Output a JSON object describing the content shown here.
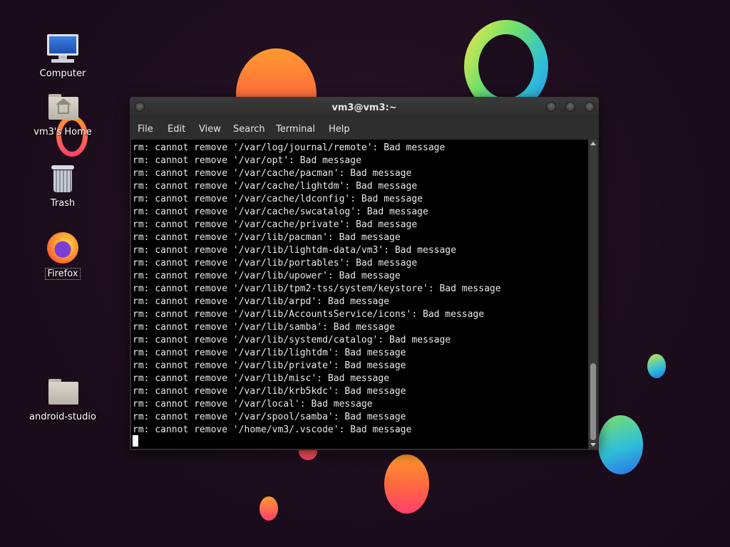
{
  "desktop": {
    "icons": [
      {
        "label": "Computer",
        "icon": "computer-icon"
      },
      {
        "label": "vm3's Home",
        "icon": "home-folder-icon"
      },
      {
        "label": "Trash",
        "icon": "trash-icon"
      },
      {
        "label": "Firefox",
        "icon": "firefox-icon"
      },
      {
        "label": "android-studio",
        "icon": "folder-icon"
      }
    ]
  },
  "terminal": {
    "title": "vm3@vm3:~",
    "menu": [
      "File",
      "Edit",
      "View",
      "Search",
      "Terminal",
      "Help"
    ],
    "lines": [
      "rm: cannot remove '/var/log/journal/remote': Bad message",
      "rm: cannot remove '/var/opt': Bad message",
      "rm: cannot remove '/var/cache/pacman': Bad message",
      "rm: cannot remove '/var/cache/lightdm': Bad message",
      "rm: cannot remove '/var/cache/ldconfig': Bad message",
      "rm: cannot remove '/var/cache/swcatalog': Bad message",
      "rm: cannot remove '/var/cache/private': Bad message",
      "rm: cannot remove '/var/lib/pacman': Bad message",
      "rm: cannot remove '/var/lib/lightdm-data/vm3': Bad message",
      "rm: cannot remove '/var/lib/portables': Bad message",
      "rm: cannot remove '/var/lib/upower': Bad message",
      "rm: cannot remove '/var/lib/tpm2-tss/system/keystore': Bad message",
      "rm: cannot remove '/var/lib/arpd': Bad message",
      "rm: cannot remove '/var/lib/AccountsService/icons': Bad message",
      "rm: cannot remove '/var/lib/samba': Bad message",
      "rm: cannot remove '/var/lib/systemd/catalog': Bad message",
      "rm: cannot remove '/var/lib/lightdm': Bad message",
      "rm: cannot remove '/var/lib/private': Bad message",
      "rm: cannot remove '/var/lib/misc': Bad message",
      "rm: cannot remove '/var/lib/krb5kdc': Bad message",
      "rm: cannot remove '/var/local': Bad message",
      "rm: cannot remove '/var/spool/samba': Bad message",
      "rm: cannot remove '/home/vm3/.vscode': Bad message"
    ]
  }
}
